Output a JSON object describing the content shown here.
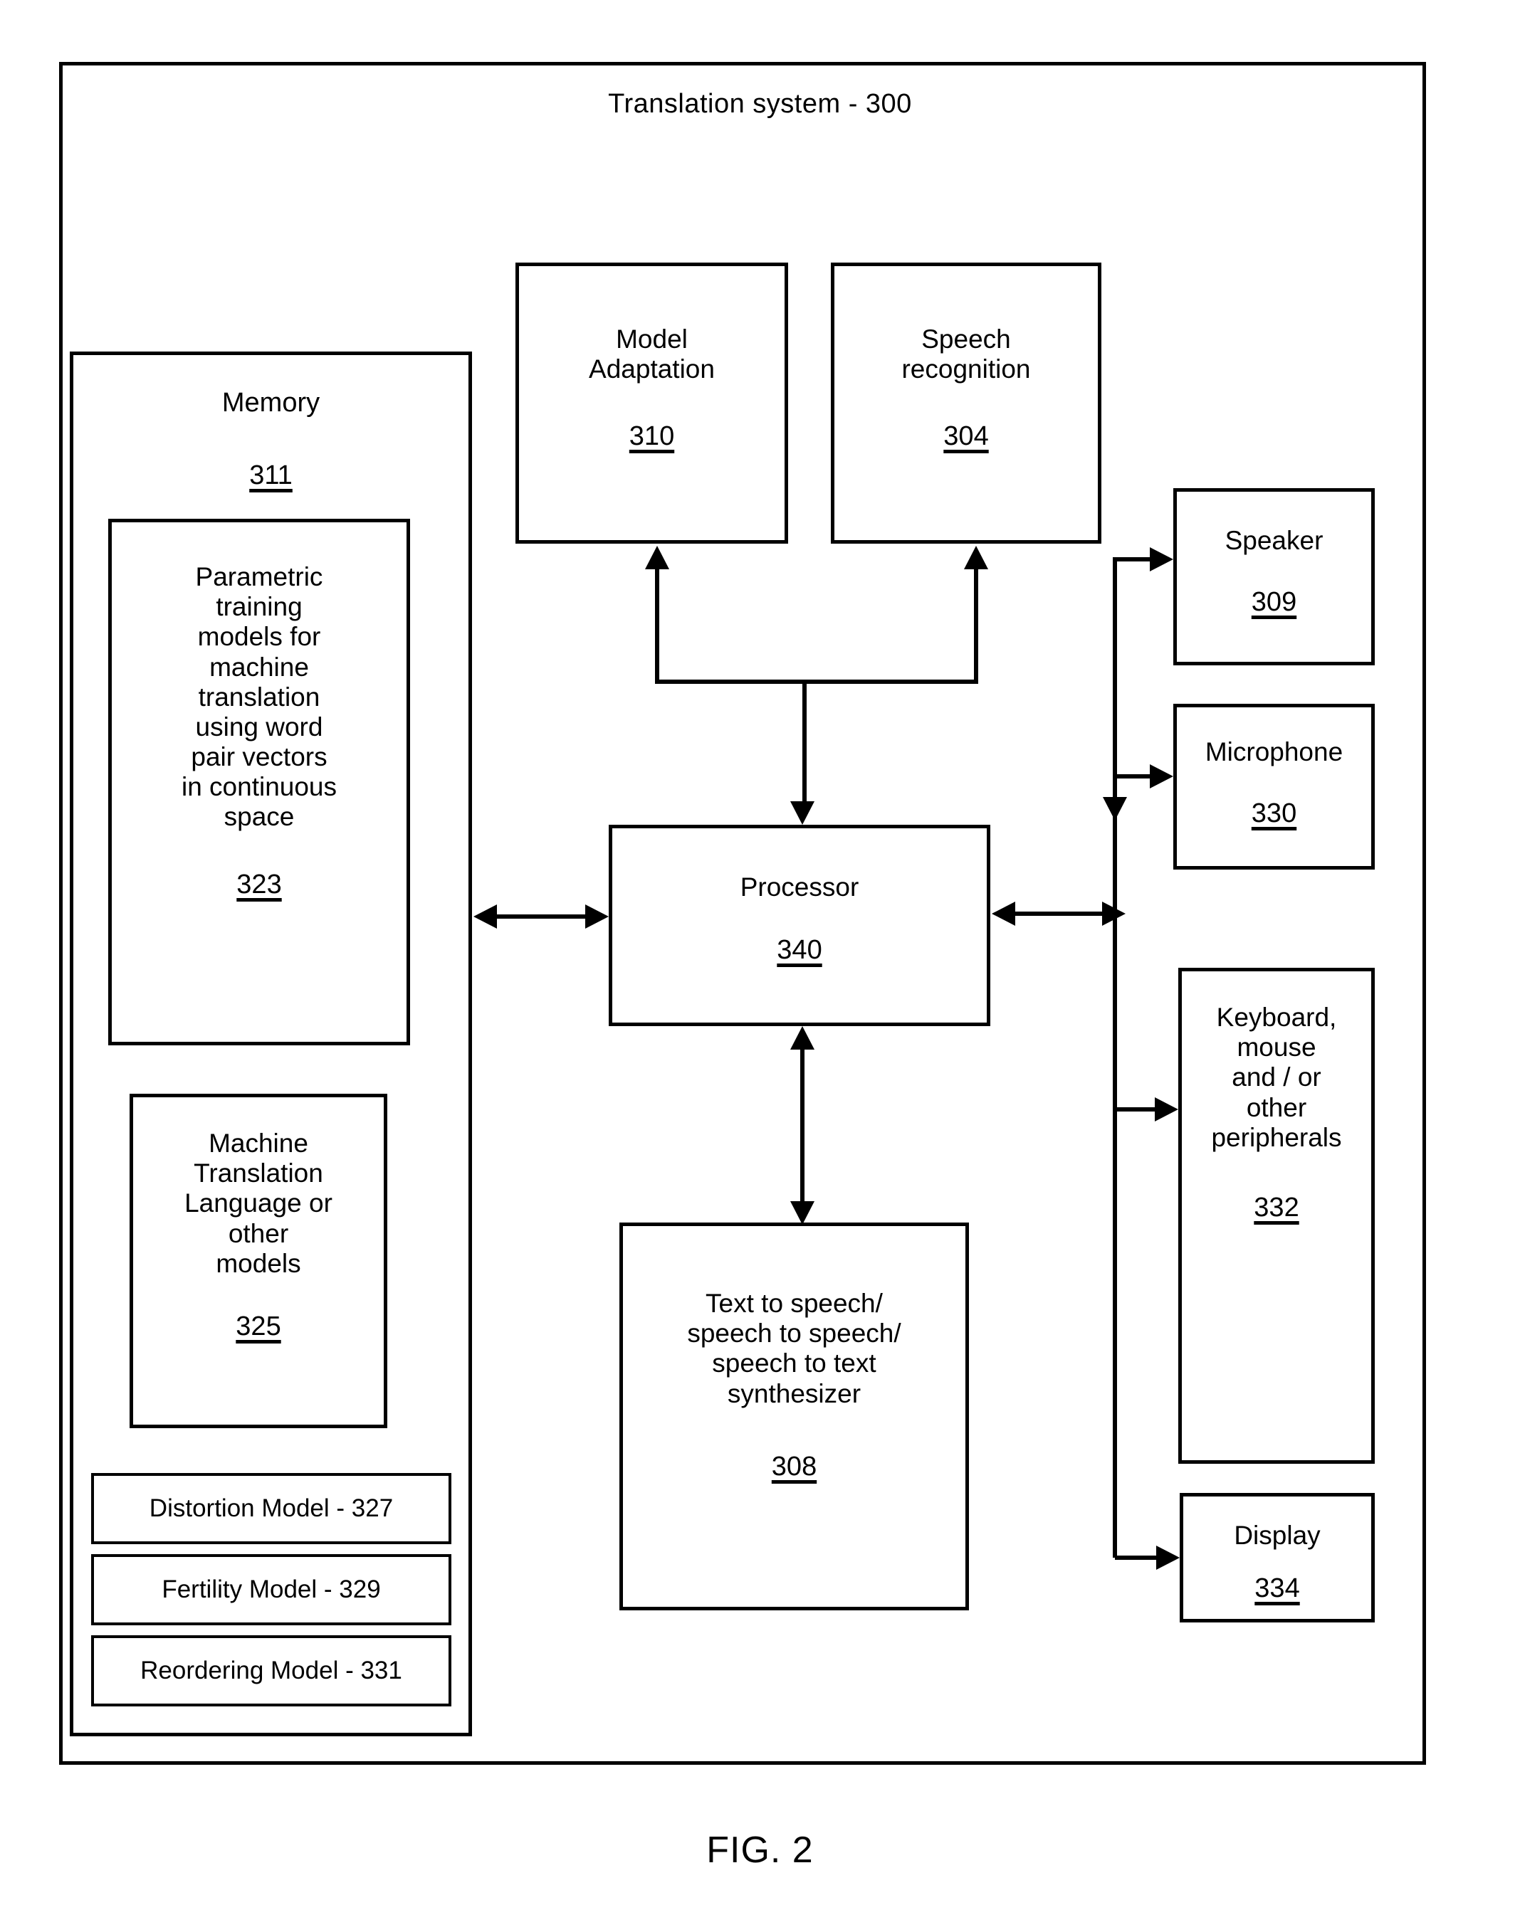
{
  "figure": {
    "caption": "FIG. 2",
    "system_title": "Translation system - 300"
  },
  "blocks": {
    "memory": {
      "label": "Memory",
      "number": "311"
    },
    "parametric_models": {
      "label": "Parametric\ntraining\nmodels for\nmachine\ntranslation\nusing word\npair vectors\nin continuous\nspace",
      "number": "323"
    },
    "mt_language_models": {
      "label": "Machine\nTranslation\nLanguage or\nother\nmodels",
      "number": "325"
    },
    "distortion_model": {
      "label": "Distortion Model - 327"
    },
    "fertility_model": {
      "label": "Fertility Model - 329"
    },
    "reordering_model": {
      "label": "Reordering Model - 331"
    },
    "model_adaptation": {
      "label": "Model\nAdaptation",
      "number": "310"
    },
    "speech_recognition": {
      "label": "Speech\nrecognition",
      "number": "304"
    },
    "processor": {
      "label": "Processor",
      "number": "340"
    },
    "synthesizer": {
      "label": "Text to speech/\nspeech to speech/\nspeech to text\nsynthesizer",
      "number": "308"
    },
    "speaker": {
      "label": "Speaker",
      "number": "309"
    },
    "microphone": {
      "label": "Microphone",
      "number": "330"
    },
    "peripherals": {
      "label": "Keyboard,\nmouse\nand / or\nother\nperipherals",
      "number": "332"
    },
    "display": {
      "label": "Display",
      "number": "334"
    }
  },
  "connections": [
    {
      "from": "memory",
      "to": "processor",
      "type": "bidirectional"
    },
    {
      "from": "processor",
      "to": "model_adaptation",
      "type": "up-arrow"
    },
    {
      "from": "processor",
      "to": "speech_recognition",
      "type": "up-arrow"
    },
    {
      "from": "model_adaptation",
      "to": "processor",
      "type": "down-arrow"
    },
    {
      "from": "processor",
      "to": "synthesizer",
      "type": "bidirectional"
    },
    {
      "from": "processor",
      "to": "peripheral_bus",
      "type": "bidirectional"
    },
    {
      "from": "peripheral_bus",
      "to": "speaker",
      "type": "arrow"
    },
    {
      "from": "peripheral_bus",
      "to": "microphone",
      "type": "arrow"
    },
    {
      "from": "peripheral_bus",
      "to": "peripherals",
      "type": "arrow"
    },
    {
      "from": "peripheral_bus",
      "to": "display",
      "type": "arrow"
    }
  ],
  "style": {
    "line_color": "#000000",
    "background_color": "#ffffff"
  }
}
